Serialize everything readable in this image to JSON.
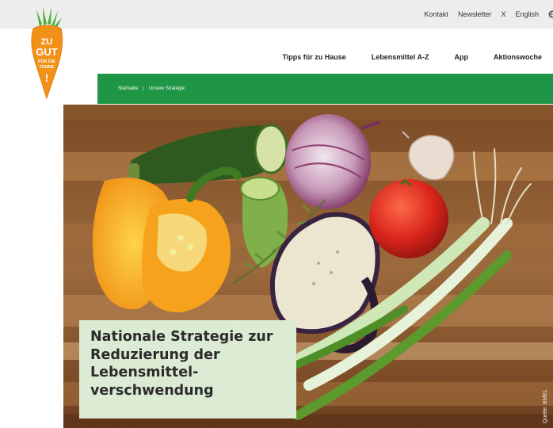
{
  "utility": {
    "links": [
      "Kontakt",
      "Newsletter",
      "X",
      "English"
    ],
    "icon": "globe-icon"
  },
  "logo": {
    "lines": [
      "ZU",
      "GUT",
      "FÜR DIE",
      "TONNE",
      "!"
    ],
    "colors": {
      "carrot": "#f29118",
      "leaf": "#4fae3c",
      "text": "#ffffff"
    }
  },
  "nav": {
    "items": [
      "Tipps für zu Hause",
      "Lebensmittel A-Z",
      "App",
      "Aktionswoche"
    ]
  },
  "breadcrumb": {
    "items": [
      "Startseite",
      "Unsere Strategie"
    ],
    "color": "#1e9646"
  },
  "hero": {
    "title_lines": [
      "Nationale Strategie zur",
      "Reduzierung der",
      "Lebensmittel-",
      "verschwendung"
    ],
    "credit": "Quelle: BMEL",
    "box_color": "#dcebd3"
  }
}
